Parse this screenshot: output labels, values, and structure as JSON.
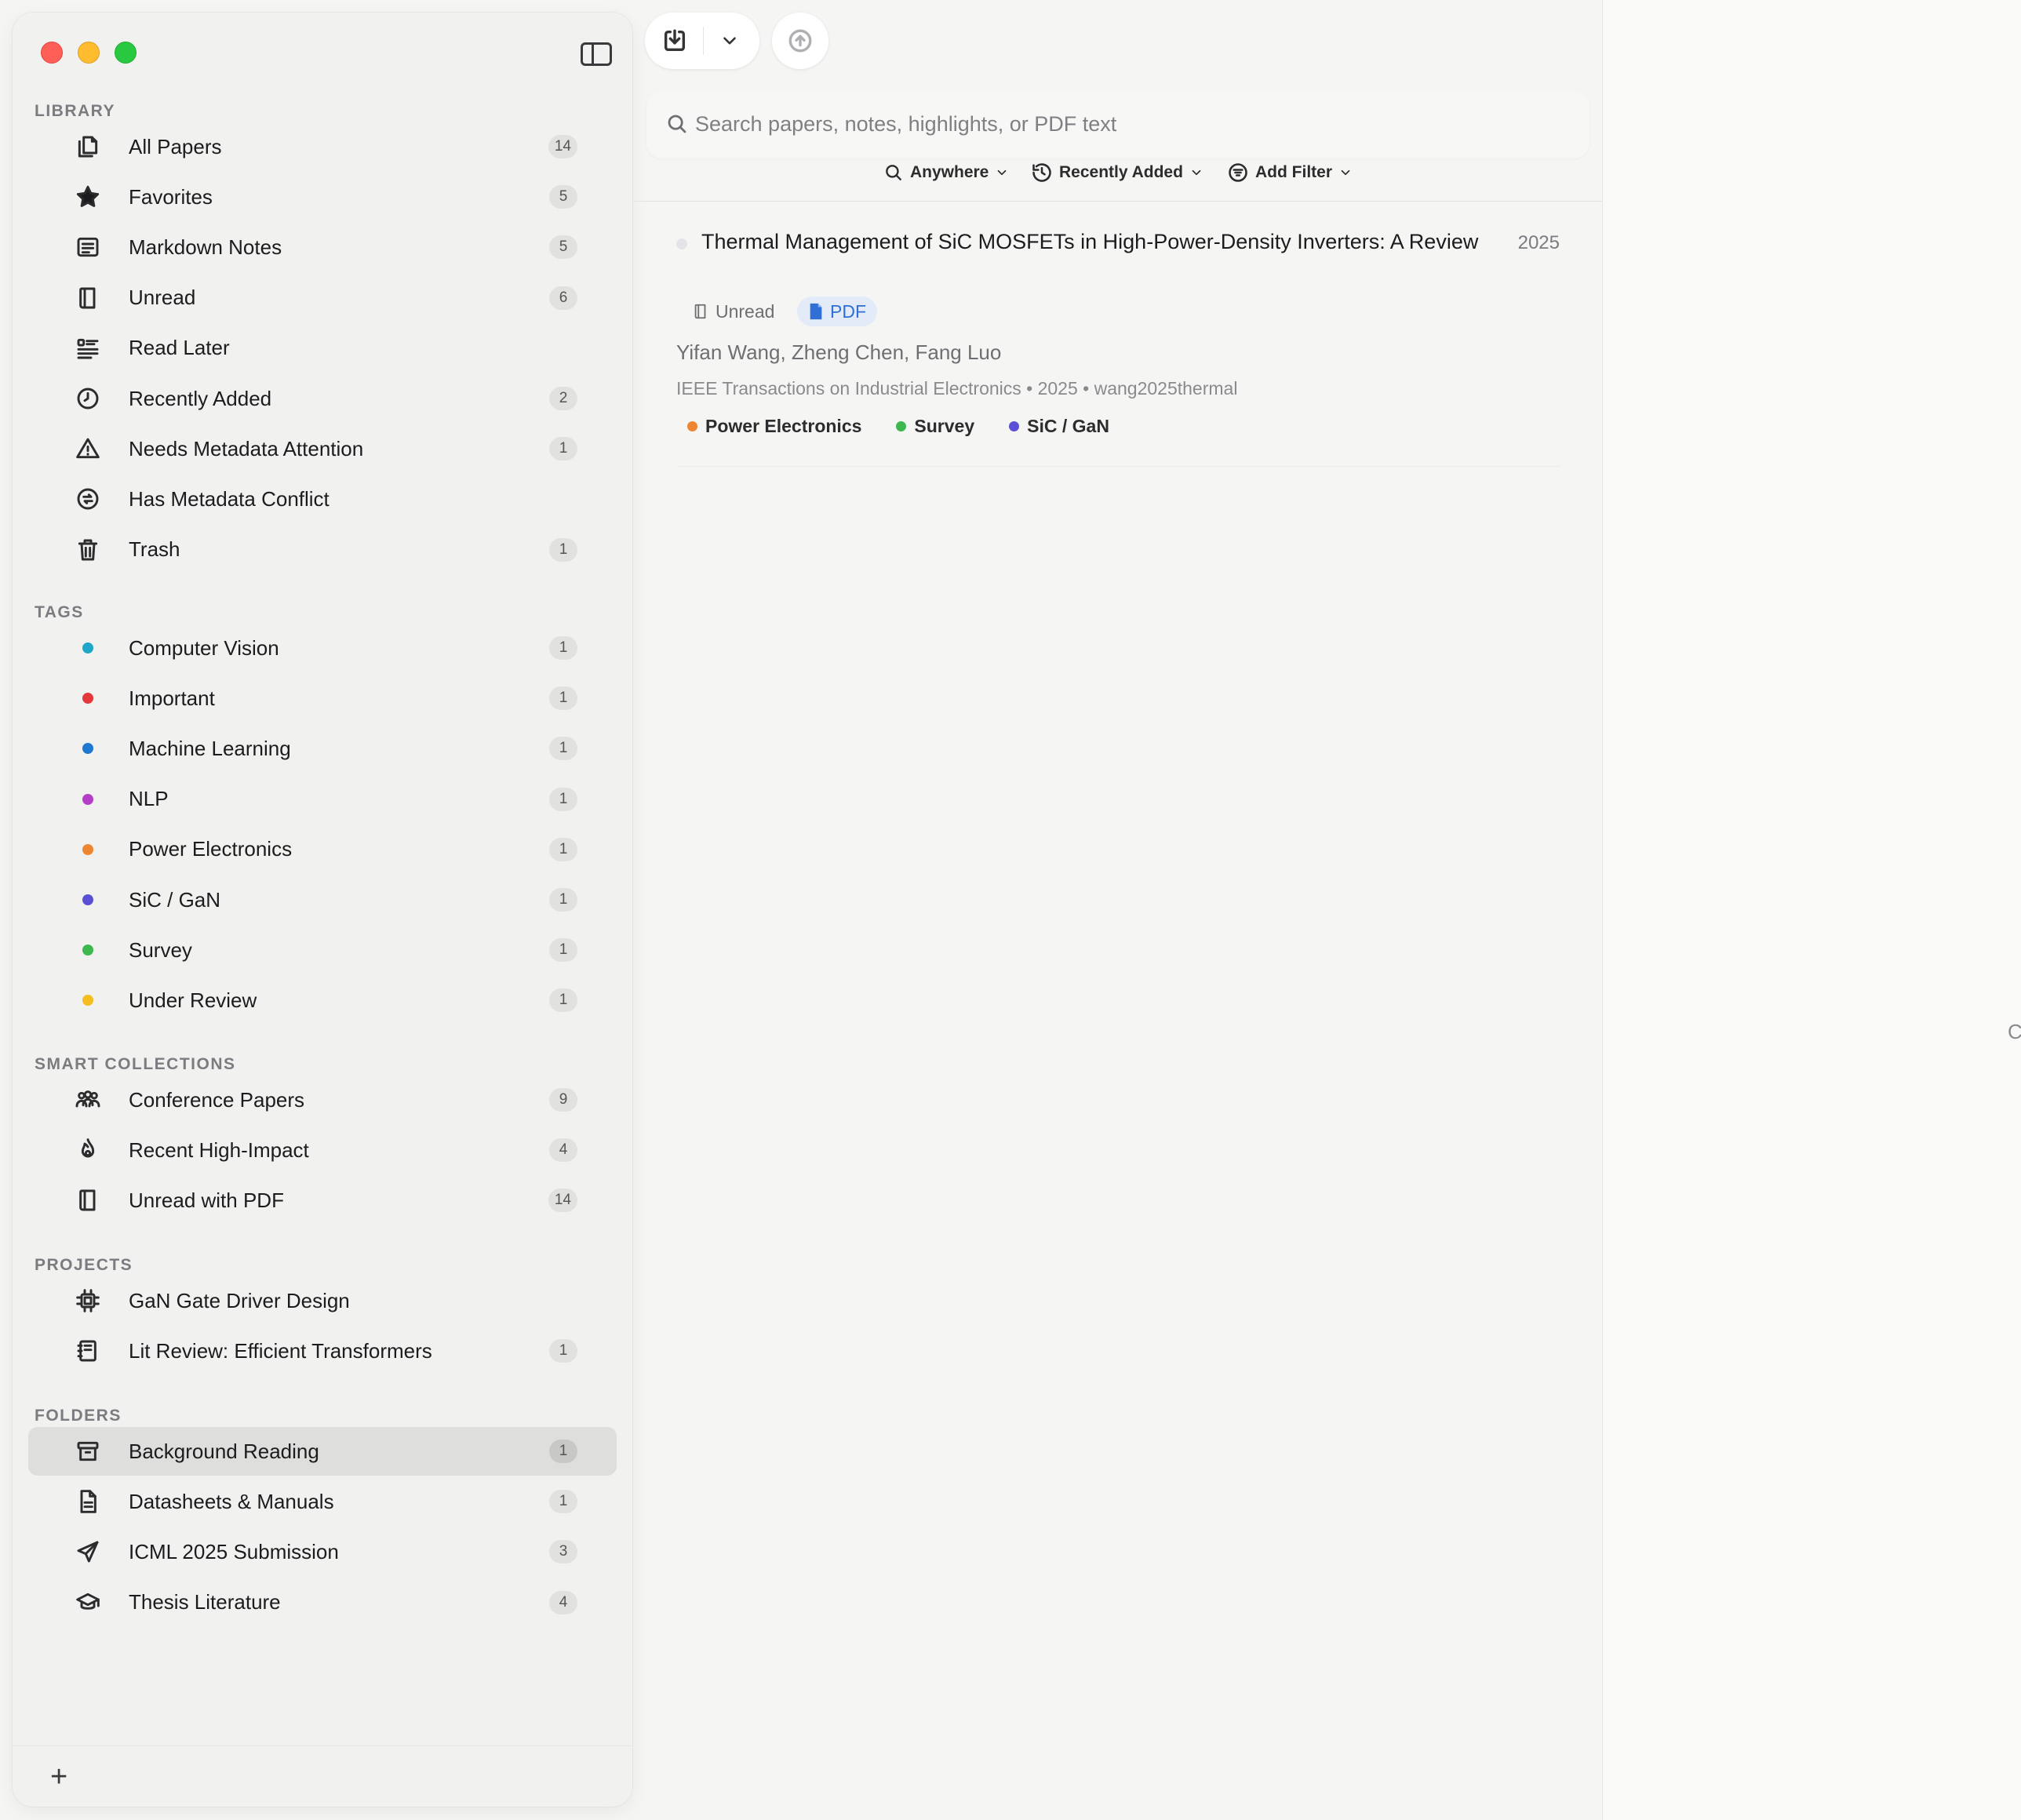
{
  "sidebar": {
    "sections": [
      {
        "title": "LIBRARY",
        "items": [
          {
            "label": "All Papers",
            "count": "14",
            "icon": "papers-icon"
          },
          {
            "label": "Favorites",
            "count": "5",
            "icon": "star-icon"
          },
          {
            "label": "Markdown Notes",
            "count": "5",
            "icon": "notes-icon"
          },
          {
            "label": "Unread",
            "count": "6",
            "icon": "book-icon"
          },
          {
            "label": "Read Later",
            "count": "",
            "icon": "list-icon"
          },
          {
            "label": "Recently Added",
            "count": "2",
            "icon": "clock-icon"
          },
          {
            "label": "Needs Metadata Attention",
            "count": "1",
            "icon": "warning-icon"
          },
          {
            "label": "Has Metadata Conflict",
            "count": "",
            "icon": "conflict-icon"
          },
          {
            "label": "Trash",
            "count": "1",
            "icon": "trash-icon"
          }
        ]
      },
      {
        "title": "TAGS",
        "items": [
          {
            "label": "Computer Vision",
            "count": "1",
            "color": "#1ea7c7"
          },
          {
            "label": "Important",
            "count": "1",
            "color": "#e5383b"
          },
          {
            "label": "Machine Learning",
            "count": "1",
            "color": "#1f78d1"
          },
          {
            "label": "NLP",
            "count": "1",
            "color": "#b43ec7"
          },
          {
            "label": "Power Electronics",
            "count": "1",
            "color": "#ee8530"
          },
          {
            "label": "SiC / GaN",
            "count": "1",
            "color": "#5b4fd6"
          },
          {
            "label": "Survey",
            "count": "1",
            "color": "#3db84e"
          },
          {
            "label": "Under Review",
            "count": "1",
            "color": "#f5bd1f"
          }
        ]
      },
      {
        "title": "SMART COLLECTIONS",
        "items": [
          {
            "label": "Conference Papers",
            "count": "9",
            "icon": "people-icon"
          },
          {
            "label": "Recent High-Impact",
            "count": "4",
            "icon": "flame-icon"
          },
          {
            "label": "Unread with PDF",
            "count": "14",
            "icon": "book-icon"
          }
        ]
      },
      {
        "title": "PROJECTS",
        "items": [
          {
            "label": "GaN Gate Driver Design",
            "count": "",
            "icon": "chip-icon"
          },
          {
            "label": "Lit Review: Efficient Transformers",
            "count": "1",
            "icon": "notebook-icon"
          }
        ]
      },
      {
        "title": "FOLDERS",
        "items": [
          {
            "label": "Background Reading",
            "count": "1",
            "icon": "archive-icon",
            "selected": true
          },
          {
            "label": "Datasheets & Manuals",
            "count": "1",
            "icon": "document-icon"
          },
          {
            "label": "ICML 2025 Submission",
            "count": "3",
            "icon": "send-icon"
          },
          {
            "label": "Thesis Literature",
            "count": "4",
            "icon": "graduation-cap-icon"
          }
        ]
      }
    ],
    "add_label": "+"
  },
  "search": {
    "placeholder": "Search papers, notes, highlights, or PDF text",
    "value": ""
  },
  "filters": {
    "scope": "Anywhere",
    "sort": "Recently Added",
    "add_filter": "Add Filter"
  },
  "papers": [
    {
      "title": "Thermal Management of SiC MOSFETs in High-Power-Density Inverters: A Review",
      "year": "2025",
      "status": "Unread",
      "pdf_label": "PDF",
      "authors": "Yifan Wang, Zheng Chen, Fang Luo",
      "venue_line": "IEEE Transactions on Industrial Electronics • 2025 • wang2025thermal",
      "tags": [
        {
          "label": "Power Electronics",
          "color": "#ee8530"
        },
        {
          "label": "Survey",
          "color": "#3db84e"
        },
        {
          "label": "SiC / GaN",
          "color": "#5b4fd6"
        }
      ]
    }
  ],
  "right_pane": {
    "hint": "C"
  },
  "colors": {
    "accent": "#2f6fd6",
    "selected_bg": "#dededc"
  }
}
